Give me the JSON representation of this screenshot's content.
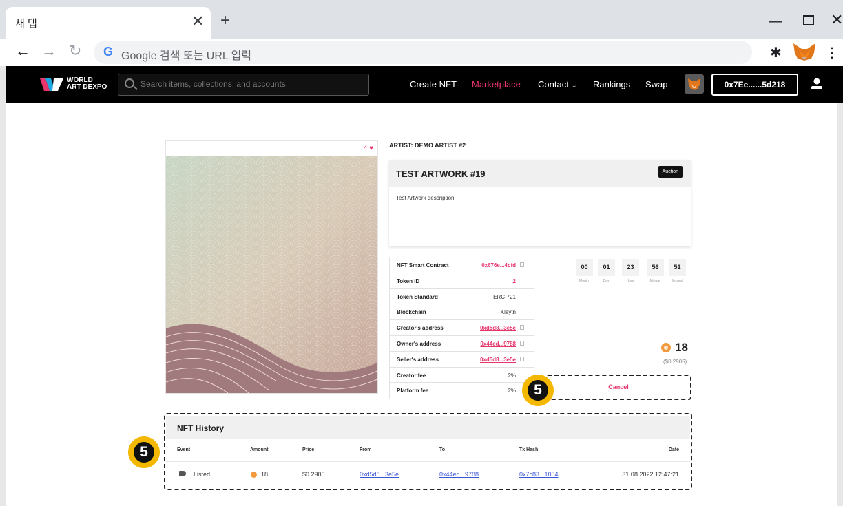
{
  "browser": {
    "tab_title": "새 탭",
    "tab_close": "✕",
    "new_tab": "+",
    "omnibox_placeholder": "Google 검색 또는 URL 입력",
    "google_g": "G"
  },
  "header": {
    "logo_line1": "WORLD",
    "logo_line2": "ART DEXPO",
    "search_placeholder": "Search items, collections, and accounts",
    "nav": {
      "create": "Create NFT",
      "marketplace": "Marketplace",
      "contact": "Contact",
      "contact_chevron": "⌄",
      "rankings": "Rankings",
      "swap": "Swap"
    },
    "wallet": "0x7Ee......5d218",
    "active_color": "#e8366d"
  },
  "artwork": {
    "likes": "4",
    "artist": "ARTIST: DEMO ARTIST #2",
    "title": "TEST ARTWORK #19",
    "badge": "Auction",
    "description": "Test Artwork description"
  },
  "details": [
    {
      "label": "NFT Smart Contract",
      "value": "0x676e...4cfd",
      "type": "link"
    },
    {
      "label": "Token ID",
      "value": "2",
      "type": "pink"
    },
    {
      "label": "Token Standard",
      "value": "ERC-721",
      "type": "plain"
    },
    {
      "label": "Blockchain",
      "value": "Klaytn",
      "type": "plain"
    },
    {
      "label": "Creator's address",
      "value": "0xd5d8...3e5e",
      "type": "link"
    },
    {
      "label": "Owner's address",
      "value": "0x44ed...9788",
      "type": "link"
    },
    {
      "label": "Seller's address",
      "value": "0xd5d8...3e5e",
      "type": "link"
    },
    {
      "label": "Creator fee",
      "value": "2%",
      "type": "plain"
    },
    {
      "label": "Platform fee",
      "value": "2%",
      "type": "plain"
    }
  ],
  "countdown": {
    "values": [
      "00",
      "01",
      "23",
      "56",
      "51"
    ],
    "labels": [
      "Month",
      "Day",
      "Hour",
      "Minute",
      "Second"
    ]
  },
  "price": {
    "amount": "18",
    "usd": "($0.2905)"
  },
  "cancel_label": "Cancel",
  "marker_number": "5",
  "history": {
    "title": "NFT History",
    "columns": [
      "Event",
      "Amount",
      "Price",
      "From",
      "To",
      "Tx Hash",
      "Date"
    ],
    "rows": [
      {
        "event": "Listed",
        "amount": "18",
        "price": "$0.2905",
        "from": "0xd5d8...3e5e",
        "to": "0x44ed...9788",
        "tx": "0x7c83...1054",
        "date": "31.08.2022 12:47:21"
      }
    ]
  }
}
